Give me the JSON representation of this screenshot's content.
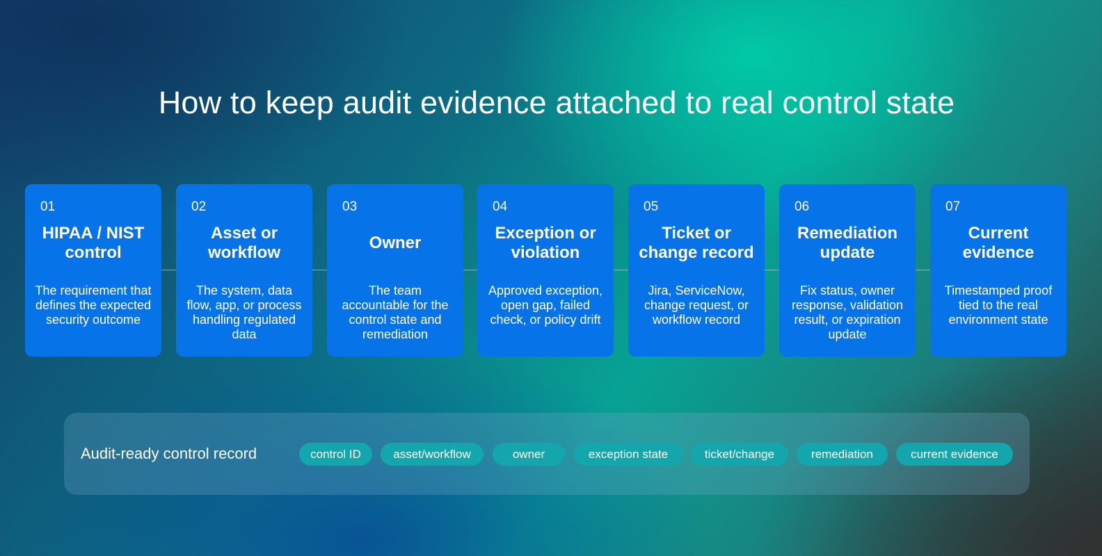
{
  "title": "How to keep audit evidence attached to real control state",
  "steps": [
    {
      "num": "01",
      "title": "HIPAA / NIST control",
      "desc": "The requirement that defines the expected security outcome"
    },
    {
      "num": "02",
      "title": "Asset or workflow",
      "desc": "The system, data flow, app, or process handling regulated data"
    },
    {
      "num": "03",
      "title": "Owner",
      "desc": "The team accountable for the control state and remediation"
    },
    {
      "num": "04",
      "title": "Exception or violation",
      "desc": "Approved exception, open gap, failed check, or policy drift"
    },
    {
      "num": "05",
      "title": "Ticket or change record",
      "desc": "Jira, ServiceNow, change request, or workflow record"
    },
    {
      "num": "06",
      "title": "Remediation update",
      "desc": "Fix status, owner response, validation result, or expiration update"
    },
    {
      "num": "07",
      "title": "Current evidence",
      "desc": "Timestamped proof tied to the real environment state"
    }
  ],
  "record": {
    "label": "Audit-ready control record",
    "chips": [
      "control ID",
      "asset/workflow",
      "owner",
      "exception state",
      "ticket/change",
      "remediation",
      "current evidence"
    ]
  },
  "colors": {
    "card": "#0673e8",
    "chip": "#13a6ad",
    "text": "#ffffff"
  }
}
